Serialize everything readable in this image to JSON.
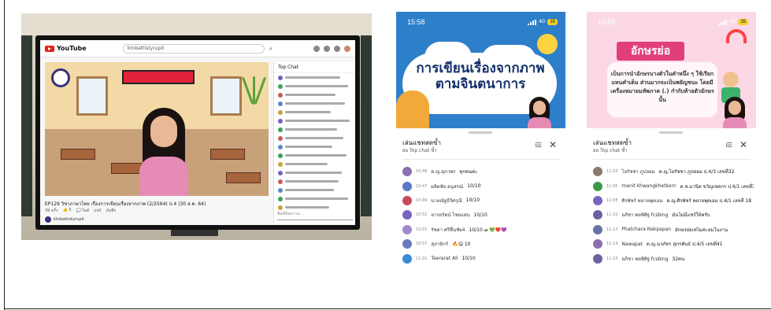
{
  "photo": {
    "youtube": {
      "logo": "YouTube",
      "search_query": "ktnbattistyrupit",
      "search_glyph": "⌕",
      "video_title": "EP129 วิชาภาษาไทย เรื่องการเขียนเรื่องจากภาพ (2/2564) ป.4 (30 ส.ค. 64)",
      "meta": [
        "39 ครั้ง",
        "👍 3",
        "💬 ไลค์",
        "แชร์",
        "บันทึก"
      ],
      "channel": "ktnbattistyrupit",
      "chat_header": "Top Chat",
      "chat_input": "พิมพ์ข้อความ...",
      "chat_rows": [
        {
          "color": "#7a5ec7",
          "w": 70
        },
        {
          "color": "#3aa35a",
          "w": 80
        },
        {
          "color": "#c85a5a",
          "w": 64
        },
        {
          "color": "#5a8ac8",
          "w": 76
        },
        {
          "color": "#c8a23a",
          "w": 58
        },
        {
          "color": "#7a5ec7",
          "w": 82
        },
        {
          "color": "#3aa35a",
          "w": 66
        },
        {
          "color": "#c85a5a",
          "w": 74
        },
        {
          "color": "#5a8ac8",
          "w": 60
        },
        {
          "color": "#3aa35a",
          "w": 78
        },
        {
          "color": "#c8a23a",
          "w": 54
        },
        {
          "color": "#7a5ec7",
          "w": 72
        },
        {
          "color": "#c85a5a",
          "w": 68
        },
        {
          "color": "#5a8ac8",
          "w": 62
        },
        {
          "color": "#3aa35a",
          "w": 80
        },
        {
          "color": "#c8a23a",
          "w": 56
        }
      ]
    }
  },
  "phone1": {
    "time": "15:58",
    "network": "4G",
    "battery": "35",
    "banner_title": "การเขียนเรื่องจากภาพตามจินตนาการ",
    "chat_title": "เล่นแชทสดซ้ำ",
    "chat_subtitle": "ย่อ Top chat ซ้ำ",
    "filter_icon": "⁞☰",
    "close_icon": "✕",
    "messages": [
      {
        "time": "10:46",
        "author": "ด.ญ.สุภาพร",
        "text": "ทุกคนค่ะ",
        "color": "#8a6fb0"
      },
      {
        "time": "10:47",
        "author": "ผลิตชัย อนุสรณ์",
        "text": "10/10",
        "color": "#5a7ac8"
      },
      {
        "time": "10:49",
        "author": "นายณัฐธีร์ศรุณี",
        "text": "10/10",
        "color": "#c84a5a"
      },
      {
        "time": "10:52",
        "author": "อารยรัตน์ ไชยแสน",
        "text": "10/10",
        "color": "#7a62c0"
      },
      {
        "time": "10:55",
        "author": "รัชดา ศรีชื่นชัย4",
        "text": "10/10 ๗ 💚❤️💜",
        "color": "#a08ad0"
      },
      {
        "time": "10:57",
        "author": "สุภาษิกร์",
        "text": "🔥😋 10",
        "color": "#6a7ab8"
      },
      {
        "time": "11:01",
        "author": "Teerarat Ali",
        "text": "10/10",
        "color": "#3a8ad8"
      }
    ]
  },
  "phone2": {
    "time": "15:59",
    "network": "4G",
    "battery": "35",
    "banner_ribbon": "อักษรย่อ",
    "banner_text": "เป็นการนำอักษรบางตัวในคำหนึ่ง ๆ ใช้เรียกแทนคำเต็ม ส่วนมากจะเป็นพยัญชนะ โดยมีเครื่องหมายมหัพภาค (.) กำกับท้ายตัวอักษรนั้น",
    "chat_title": "เล่นแชทสดซ้ำ",
    "chat_subtitle": "ย่อ Top chat ซ้ำ",
    "filter_icon": "⁞☰",
    "close_icon": "✕",
    "messages": [
      {
        "time": "11:03",
        "author": "ไอรัชชา ภูปลอม",
        "text": "ด.ญ.ไอรัชชา ภูปลอม ป.4/3 เลขที่32",
        "color": "#8a7a6a"
      },
      {
        "time": "11:05",
        "author": "manit khwangkhetkorn",
        "text": "ด.ช.มานิต ขวัญเขตกร ป.4/1 เลขที่3",
        "color": "#3a9a4a"
      },
      {
        "time": "11:08",
        "author": "ศิรพัชร์ พลายพุดเอม",
        "text": "ด.ญ.ศิรพัชร์ พลายพุดเอม ป.4/1 เลขที่ 18",
        "color": "#7a62c0"
      },
      {
        "time": "11:10",
        "author": "อภิชา พลพิสิฐ fcsbing",
        "text": "มันไม่มีแชร์ให้ครับ",
        "color": "#6a62a0"
      },
      {
        "time": "11:12",
        "author": "Phatchara Nakpapan",
        "text": "อักษรย่อเท่ไมค่ะอมโนงาน",
        "color": "#6a72a8"
      },
      {
        "time": "11:14",
        "author": "Nawapat",
        "text": "ด.ญ.นวภัทร สุภรพันธ์ ป.4/5 เลขที่41",
        "color": "#8a6fb0"
      },
      {
        "time": "11:15",
        "author": "อภิชา พลพิสิฐ fcsbing",
        "text": "32คน",
        "color": "#6a62a0"
      }
    ]
  }
}
